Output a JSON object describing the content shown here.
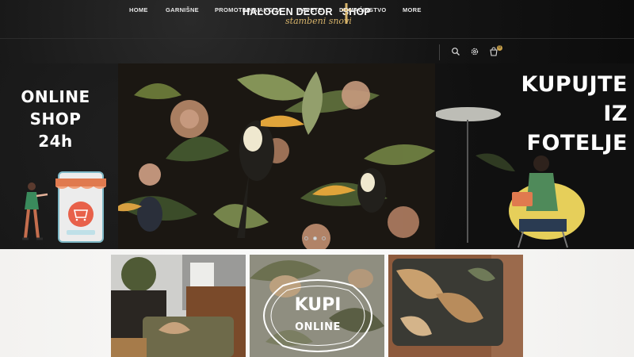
{
  "header": {
    "logo_main": "HALOGEN DECOR",
    "logo_shop": "SHOP",
    "logo_tagline": "stambeni snovi",
    "nav": [
      {
        "label": "HOME"
      },
      {
        "label": "GARNIŠNE"
      },
      {
        "label": "PROMOTIVNA AKCIJA"
      },
      {
        "label": "TAPETE"
      },
      {
        "label": "DOMAĆINSTVO"
      },
      {
        "label": "MORE"
      }
    ],
    "icons": [
      "search-icon",
      "settings-icon",
      "cart-icon"
    ],
    "cart_count": "0"
  },
  "banner": {
    "left_text": [
      "ONLINE",
      "SHOP",
      "24h"
    ],
    "right_text": [
      "KUPUJTE",
      "IZ",
      "FOTELJE"
    ],
    "slides": 3,
    "active_slide": 1
  },
  "promo": {
    "line1": "KUPI",
    "line2": "ONLINE"
  },
  "colors": {
    "accent": "#c9a14a",
    "header_bg": "#141414",
    "text_light": "#ffffff",
    "lower_bg": "#f5f4f2"
  }
}
